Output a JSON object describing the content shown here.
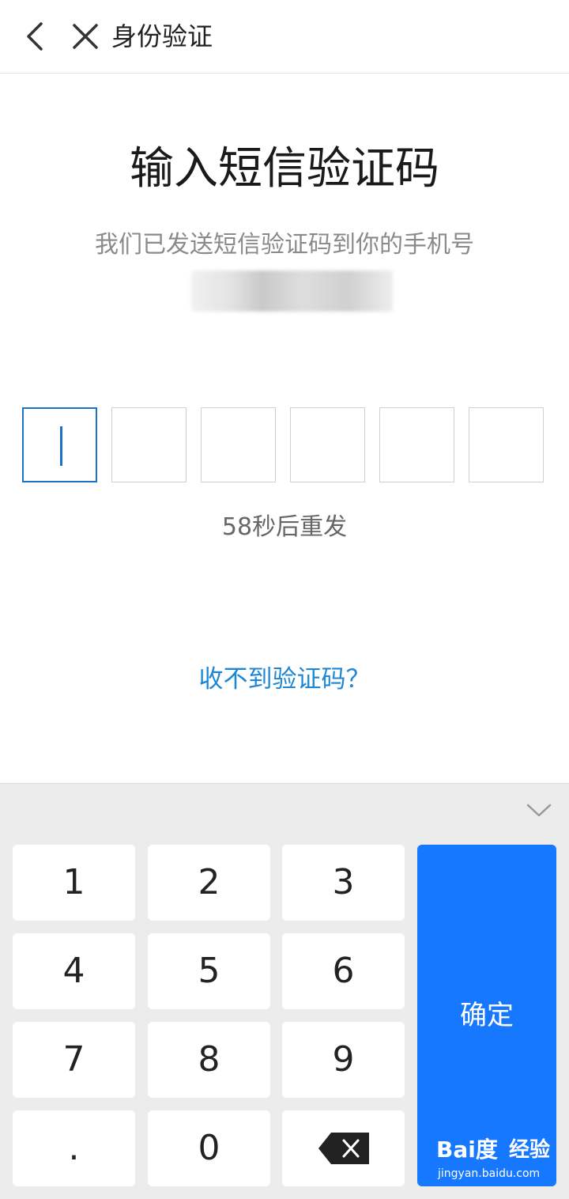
{
  "header": {
    "title": "身份验证",
    "back_icon": "chevron-left-icon",
    "close_icon": "close-icon"
  },
  "main": {
    "title": "输入短信验证码",
    "subtitle": "我们已发送短信验证码到你的手机号",
    "code_length": 6,
    "code_values": [
      "",
      "",
      "",
      "",
      "",
      ""
    ],
    "resend_text": "58秒后重发",
    "no_code_link": "收不到验证码？"
  },
  "keyboard": {
    "keys": [
      {
        "label": "1"
      },
      {
        "label": "2"
      },
      {
        "label": "3"
      },
      {
        "label": "4"
      },
      {
        "label": "5"
      },
      {
        "label": "6"
      },
      {
        "label": "7"
      },
      {
        "label": "8"
      },
      {
        "label": "9"
      },
      {
        "label": "."
      },
      {
        "label": "0"
      }
    ],
    "backspace_icon": "backspace-icon",
    "confirm_label": "确定",
    "collapse_icon": "chevron-down-icon"
  },
  "watermark": {
    "logo": "Bai度",
    "brand": "经验",
    "url": "jingyan.baidu.com"
  },
  "colors": {
    "accent": "#1677ff",
    "link": "#1d87d6",
    "active_border": "#1a73c8"
  }
}
